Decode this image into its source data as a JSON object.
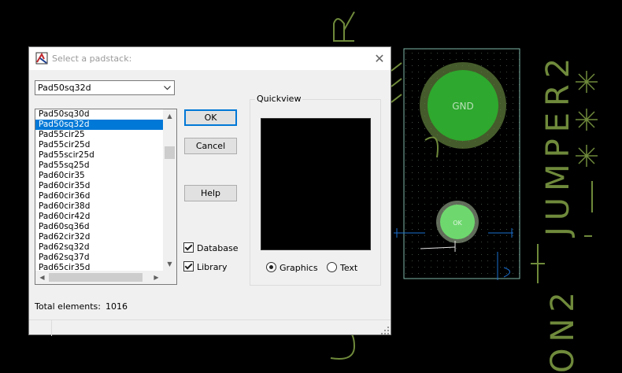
{
  "dialog": {
    "title": "Select a padstack:",
    "combo_value": "Pad50sq32d",
    "list": {
      "items": [
        "Pad50sq30d",
        "Pad50sq32d",
        "Pad55cir25",
        "Pad55cir25d",
        "Pad55scir25d",
        "Pad55sq25d",
        "Pad60cir35",
        "Pad60cir35d",
        "Pad60cir36d",
        "Pad60cir38d",
        "Pad60cir42d",
        "Pad60sq36d",
        "Pad62cir32d",
        "Pad62sq32d",
        "Pad62sq37d",
        "Pad65cir35d"
      ],
      "selected_index": 1
    },
    "buttons": {
      "ok": "OK",
      "cancel": "Cancel",
      "help": "Help"
    },
    "checkboxes": {
      "database": "Database",
      "library": "Library"
    },
    "quickview": {
      "label": "Quickview",
      "graphics": "Graphics",
      "text": "Text"
    },
    "total_label": "Total elements:",
    "total_value": "1016"
  },
  "board": {
    "pad_label": "GND",
    "pad_label_small": "OK",
    "ref_vertical": "JUMPER2",
    "ref_bottom": "ON2",
    "colors": {
      "outline": "#7fb8a8",
      "pad_green": "#2ea82e",
      "pad_ring": "#5c7a3a",
      "silk": "#6f8a3b",
      "accent_blue": "#1a6fd0"
    }
  }
}
